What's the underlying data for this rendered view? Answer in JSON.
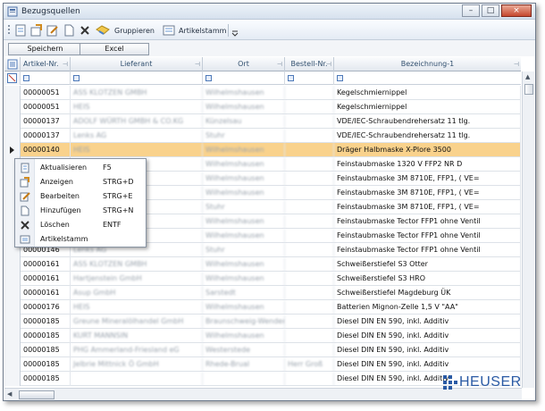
{
  "window": {
    "title": "Bezugsquellen",
    "controls": {
      "minimize": "–",
      "maximize": "□",
      "close": "×"
    }
  },
  "toolbar": {
    "gruppieren_label": "Gruppieren",
    "artikelstamm_label": "Artikelstamm"
  },
  "buttons": {
    "save": "Speichern",
    "excel": "Excel"
  },
  "grid": {
    "columns": [
      "Artikel-Nr.",
      "Lieferant",
      "Ort",
      "Bestell-Nr.",
      "Bezeichnung-1"
    ],
    "rows": [
      {
        "artikel": "00000051",
        "lieferant": "ASS KLOTZEN GMBH",
        "ort": "Wilhelmshausen",
        "bestell": "",
        "bez": "Kegelschmiernippel"
      },
      {
        "artikel": "00000051",
        "lieferant": "HEIS",
        "ort": "Wilhelmshausen",
        "bestell": "",
        "bez": "Kegelschmiernippel"
      },
      {
        "artikel": "00000137",
        "lieferant": "ADOLF WÜRTH GMBH & CO.KG",
        "ort": "Künzelsau",
        "bestell": "",
        "bez": "VDE/IEC-Schraubendrehersatz 11 tlg."
      },
      {
        "artikel": "00000137",
        "lieferant": "Lenks AG",
        "ort": "Stuhr",
        "bestell": "",
        "bez": "VDE/IEC-Schraubendrehersatz 11 tlg."
      },
      {
        "artikel": "00000140",
        "lieferant": "HEIS",
        "ort": "Wilhelmshausen",
        "bestell": "",
        "bez": "Dräger Halbmaske X-Plore 3500"
      },
      {
        "artikel": "",
        "lieferant": "",
        "ort": "Wilhelmshausen",
        "bestell": "",
        "bez": "Feinstaubmaske 1320 V FFP2 NR D"
      },
      {
        "artikel": "",
        "lieferant": "",
        "ort": "Wilhelmshausen",
        "bestell": "",
        "bez": "Feinstaubmaske 3M 8710E, FFP1, ( VE="
      },
      {
        "artikel": "",
        "lieferant": "",
        "ort": "Wilhelmshausen",
        "bestell": "",
        "bez": "Feinstaubmaske 3M 8710E, FFP1, ( VE="
      },
      {
        "artikel": "",
        "lieferant": "",
        "ort": "Stuhr",
        "bestell": "",
        "bez": "Feinstaubmaske 3M 8710E, FFP1, ( VE="
      },
      {
        "artikel": "",
        "lieferant": "",
        "ort": "Wilhelmshausen",
        "bestell": "",
        "bez": "Feinstaubmaske Tector FFP1 ohne Ventil"
      },
      {
        "artikel": "",
        "lieferant": "",
        "ort": "Wilhelmshausen",
        "bestell": "",
        "bez": "Feinstaubmaske Tector FFP1 ohne Ventil"
      },
      {
        "artikel": "00000146",
        "lieferant": "Lenks AG",
        "ort": "Stuhr",
        "bestell": "",
        "bez": "Feinstaubmaske Tector FFP1 ohne Ventil"
      },
      {
        "artikel": "00000161",
        "lieferant": "ASS KLOTZEN GMBH",
        "ort": "Wilhelmshausen",
        "bestell": "",
        "bez": "Schweißerstiefel S3 Otter"
      },
      {
        "artikel": "00000161",
        "lieferant": "Hartjenstein GmbH",
        "ort": "Wilhelmshausen",
        "bestell": "",
        "bez": "Schweißerstiefel S3 HRO"
      },
      {
        "artikel": "00000161",
        "lieferant": "Asup GmbH",
        "ort": "Sarstedt",
        "bestell": "",
        "bez": "Schweißerstiefel Magdeburg ÜK"
      },
      {
        "artikel": "00000176",
        "lieferant": "HEIS",
        "ort": "Wilhelmshausen",
        "bestell": "",
        "bez": "Batterien Mignon-Zelle 1,5 V \"AA\""
      },
      {
        "artikel": "00000185",
        "lieferant": "Greune Mineralölhandel GmbH",
        "ort": "Braunschweig-Wenden",
        "bestell": "",
        "bez": "Diesel DIN EN 590, inkl. Additiv"
      },
      {
        "artikel": "00000185",
        "lieferant": "KURT MANNSIN",
        "ort": "Wilhelmshausen",
        "bestell": "",
        "bez": "Diesel DIN EN 590, inkl. Additiv"
      },
      {
        "artikel": "00000185",
        "lieferant": "PHG Ammerland-Friesland eG",
        "ort": "Westerstede",
        "bestell": "",
        "bez": "Diesel DIN EN 590, inkl. Additiv"
      },
      {
        "artikel": "00000185",
        "lieferant": "Jelbrie Mittnick Ö GmbH",
        "ort": "Rhede-Brual",
        "bestell": "Herr Groß",
        "bez": "Diesel DIN EN 590, inkl. Additiv"
      },
      {
        "artikel": "00000185",
        "lieferant": "",
        "ort": "",
        "bestell": "",
        "bez": "Diesel DIN EN 590, inkl. Additiv"
      }
    ]
  },
  "context_menu": {
    "items": [
      {
        "label": "Aktualisieren",
        "shortcut": "F5",
        "icon": "refresh-icon"
      },
      {
        "label": "Anzeigen",
        "shortcut": "STRG+D",
        "icon": "view-icon"
      },
      {
        "label": "Bearbeiten",
        "shortcut": "STRG+E",
        "icon": "edit-icon"
      },
      {
        "label": "Hinzufügen",
        "shortcut": "STRG+N",
        "icon": "new-icon"
      },
      {
        "label": "Löschen",
        "shortcut": "ENTF",
        "icon": "delete-icon"
      },
      {
        "label": "Artikelstamm",
        "shortcut": "",
        "icon": "article-icon"
      }
    ]
  },
  "logo": {
    "text": "HEUSER"
  },
  "colors": {
    "selected_row": "#f9d28c",
    "header_text": "#32506f",
    "logo_blue": "#2a5aa4"
  }
}
